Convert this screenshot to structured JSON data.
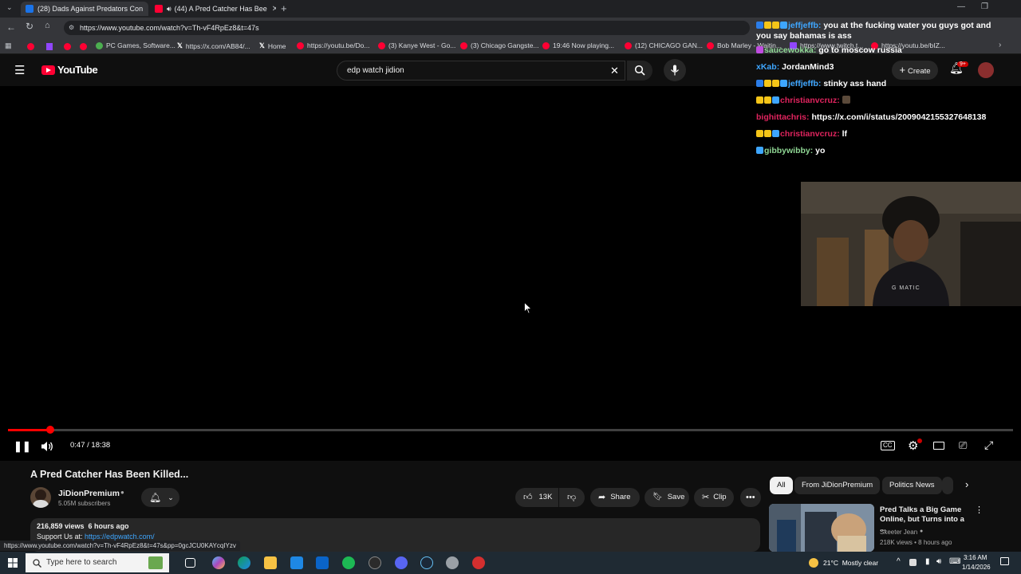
{
  "browser": {
    "tabs": [
      {
        "title": "(28) Dads Against Predators Con",
        "color": "#1a73e8"
      },
      {
        "title": "(44) A Pred Catcher Has Bee",
        "color": "#ff0033"
      }
    ],
    "url": "https://www.youtube.com/watch?v=Th-vF4RpEz8&t=47s",
    "bookmarks": [
      {
        "label": "PC Games, Software...",
        "kind": "dot"
      },
      {
        "label": "https://x.com/AB84/...",
        "kind": "x"
      },
      {
        "label": "Home",
        "kind": "x"
      },
      {
        "label": "https://youtu.be/Do...",
        "kind": "dot"
      },
      {
        "label": "(3) Kanye West - Go...",
        "kind": "dot"
      },
      {
        "label": "(3) Chicago Gangste...",
        "kind": "dot"
      },
      {
        "label": "19:46 Now playing...",
        "kind": "dot"
      },
      {
        "label": "(12) CHICAGO GAN...",
        "kind": "dot"
      },
      {
        "label": "Bob Marley - Waitin...",
        "kind": "dot"
      },
      {
        "label": "https://www.twitch.t...",
        "kind": "dot"
      },
      {
        "label": "https://youtu.be/bIZ...",
        "kind": "dot"
      }
    ],
    "status_url": "https://www.youtube.com/watch?v=Th-vF4RpEz8&t=47s&pp=0gcJCU0KAYcqIYzv"
  },
  "youtube": {
    "logo": "YouTube",
    "search_value": "edp watch jidion",
    "create_label": "Create",
    "notifications_count": "9+"
  },
  "player": {
    "time": "0:47 / 18:38",
    "progress_fraction": 0.042
  },
  "chat": [
    {
      "user": "jeffjeffb",
      "user_color": "#3ea6ff",
      "badges": [
        "#2b7de9",
        "#f5c518",
        "#f5c518",
        "#3ea6ff"
      ],
      "text": "you at the fucking water you guys got and you say bahamas is ass"
    },
    {
      "user": "saucewokka",
      "user_color": "#8fd694",
      "badges": [
        "#c04ce0"
      ],
      "text": "go to moscow russia"
    },
    {
      "user": "xKab",
      "user_color": "#3ea6ff",
      "badges": [],
      "text": "JordanMind3"
    },
    {
      "user": "jeffjeffb",
      "user_color": "#3ea6ff",
      "badges": [
        "#2b7de9",
        "#f5c518",
        "#f5c518",
        "#3ea6ff"
      ],
      "text": "stinky ass hand"
    },
    {
      "user": "christianvcruz",
      "user_color": "#e0245e",
      "badges": [
        "#f5c518",
        "#f5c518",
        "#3ea6ff"
      ],
      "text": ""
    },
    {
      "user": "bighittachris",
      "user_color": "#e0245e",
      "badges": [],
      "text": "https://x.com/i/status/2009042155327648138"
    },
    {
      "user": "christianvcruz",
      "user_color": "#e0245e",
      "badges": [
        "#f5c518",
        "#f5c518",
        "#3ea6ff"
      ],
      "text": "lf"
    },
    {
      "user": "gibbywibby",
      "user_color": "#8fd694",
      "badges": [
        "#3ea6ff"
      ],
      "text": "yo"
    }
  ],
  "video_info": {
    "title": "A Pred Catcher Has Been Killed...",
    "channel": "JiDionPremium",
    "subscribers": "5.05M subscribers",
    "likes": "13K",
    "share": "Share",
    "save": "Save",
    "clip": "Clip",
    "views_date": "216,859 views  6 hours ago",
    "support_prefix": "Support Us at:",
    "support_link": "https://edpwatch.com/"
  },
  "chips": [
    "All",
    "From JiDionPremium",
    "Politics News"
  ],
  "recommended": {
    "title": "Pred Talks a Big Game Online, but Turns into a ...",
    "channel": "Skeeter Jean",
    "meta": "218K views • 8 hours ago"
  },
  "taskbar": {
    "search_placeholder": "Type here to search",
    "weather": "21°C  Mostly clear",
    "time": "3:16 AM",
    "date": "1/14/2026"
  }
}
